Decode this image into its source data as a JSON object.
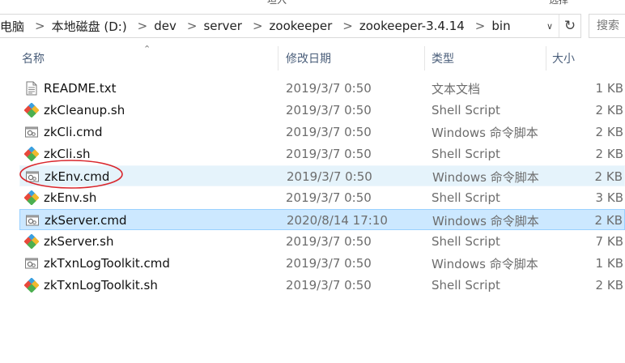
{
  "breadcrumbs": [
    "电脑",
    "本地磁盘 (D:)",
    "dev",
    "server",
    "zookeeper",
    "zookeeper-3.4.14",
    "bin"
  ],
  "search": {
    "placeholder": "搜索"
  },
  "top_fragments": [
    "坦入",
    "选择"
  ],
  "columns": {
    "name": "名称",
    "date": "修改日期",
    "type": "类型",
    "size": "大小"
  },
  "files": [
    {
      "name": "README.txt",
      "date": "2019/3/7 0:50",
      "type": "文本文档",
      "size": "1 KB",
      "icon": "text-file-icon"
    },
    {
      "name": "zkCleanup.sh",
      "date": "2019/3/7 0:50",
      "type": "Shell Script",
      "size": "2 KB",
      "icon": "shell-script-icon"
    },
    {
      "name": "zkCli.cmd",
      "date": "2019/3/7 0:50",
      "type": "Windows 命令脚本",
      "size": "2 KB",
      "icon": "cmd-file-icon"
    },
    {
      "name": "zkCli.sh",
      "date": "2019/3/7 0:50",
      "type": "Shell Script",
      "size": "2 KB",
      "icon": "shell-script-icon"
    },
    {
      "name": "zkEnv.cmd",
      "date": "2019/3/7 0:50",
      "type": "Windows 命令脚本",
      "size": "2 KB",
      "icon": "cmd-file-icon"
    },
    {
      "name": "zkEnv.sh",
      "date": "2019/3/7 0:50",
      "type": "Shell Script",
      "size": "3 KB",
      "icon": "shell-script-icon"
    },
    {
      "name": "zkServer.cmd",
      "date": "2020/8/14 17:10",
      "type": "Windows 命令脚本",
      "size": "2 KB",
      "icon": "cmd-file-icon"
    },
    {
      "name": "zkServer.sh",
      "date": "2019/3/7 0:50",
      "type": "Shell Script",
      "size": "7 KB",
      "icon": "shell-script-icon"
    },
    {
      "name": "zkTxnLogToolkit.cmd",
      "date": "2019/3/7 0:50",
      "type": "Windows 命令脚本",
      "size": "1 KB",
      "icon": "cmd-file-icon"
    },
    {
      "name": "zkTxnLogToolkit.sh",
      "date": "2019/3/7 0:50",
      "type": "Shell Script",
      "size": "2 KB",
      "icon": "shell-script-icon"
    }
  ],
  "hovered_index": 4,
  "selected_index": 6,
  "annotated_index": 4,
  "colors": {
    "accent": "#cce8ff",
    "hover": "#e5f3fb",
    "annotation": "#d9262c",
    "header_text": "#4a5e7a"
  }
}
